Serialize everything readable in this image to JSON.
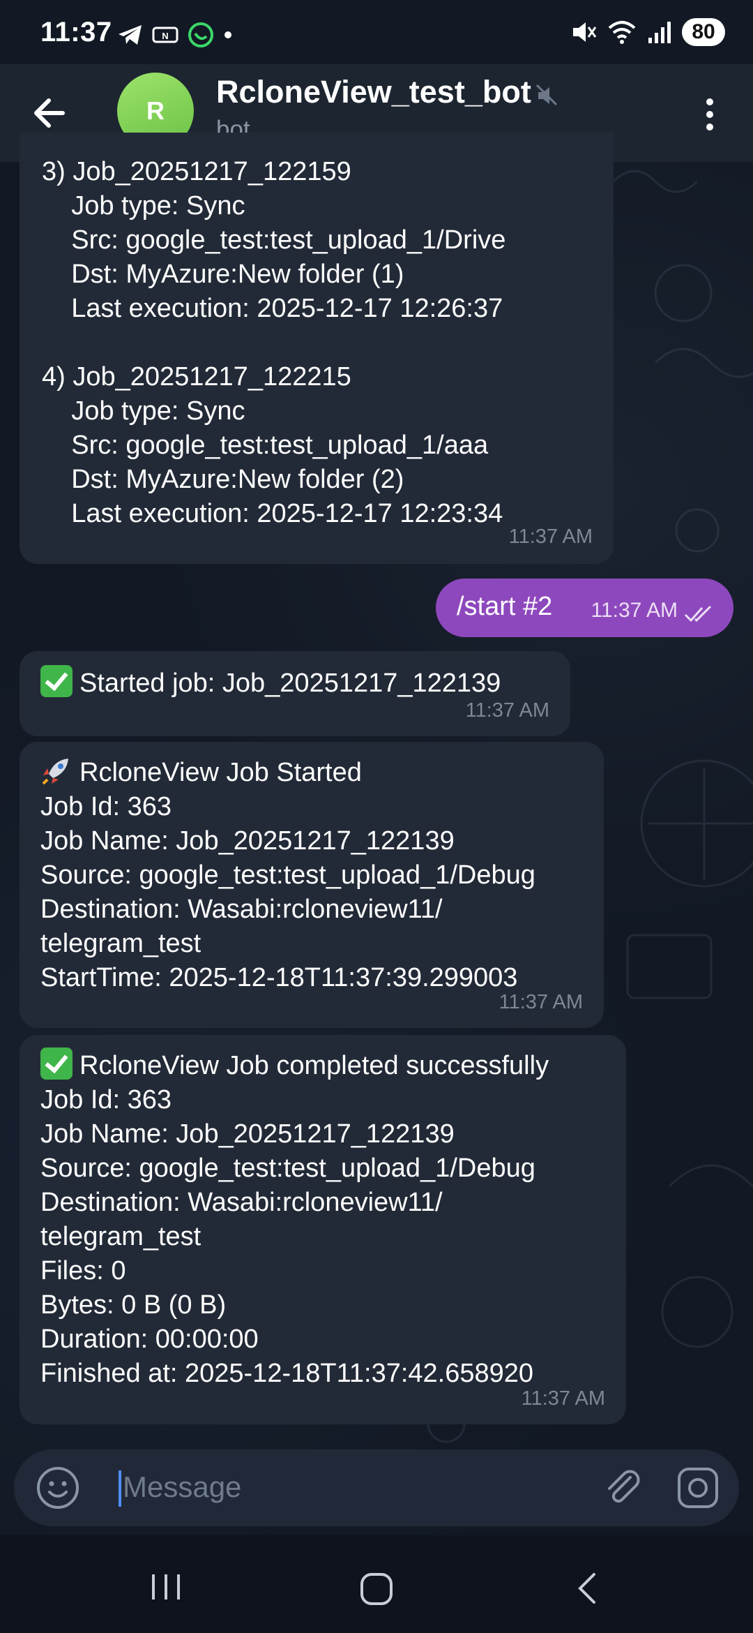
{
  "status_bar": {
    "time": "11:37",
    "battery": "80",
    "left_icons": [
      "telegram-icon",
      "nfc-icon",
      "whatsapp-icon",
      "dot-icon"
    ],
    "right_icons": [
      "mute-icon",
      "wifi-icon",
      "signal-icon",
      "battery-icon"
    ]
  },
  "header": {
    "avatar_letter": "R",
    "title": "RcloneView_test_bot",
    "subtitle": "bot"
  },
  "messages": [
    {
      "id": "jobs-list",
      "text": "3) Job_20251217_122159\n    Job type: Sync\n    Src: google_test:test_upload_1/Drive\n    Dst: MyAzure:New folder (1)\n    Last execution: 2025-12-17 12:26:37\n\n4) Job_20251217_122215\n    Job type: Sync\n    Src: google_test:test_upload_1/aaa\n    Dst: MyAzure:New folder (2)\n    Last execution: 2025-12-17 12:23:34",
      "time": "11:37 AM"
    },
    {
      "id": "outgoing",
      "text": "/start #2",
      "time": "11:37 AM"
    },
    {
      "id": "started",
      "text": "Started job: Job_20251217_122139",
      "time": "11:37 AM"
    },
    {
      "id": "job-started",
      "text": "RcloneView Job Started\nJob Id: 363\nJob Name: Job_20251217_122139\nSource: google_test:test_upload_1/Debug\nDestination: Wasabi:rcloneview11/\ntelegram_test\nStartTime: 2025-12-18T11:37:39.299003",
      "time": "11:37 AM"
    },
    {
      "id": "job-completed",
      "text": "RcloneView Job completed successfully\nJob Id: 363\nJob Name: Job_20251217_122139\nSource: google_test:test_upload_1/Debug\nDestination: Wasabi:rcloneview11/\ntelegram_test\nFiles: 0\nBytes: 0 B (0 B)\nDuration: 00:00:00\nFinished at: 2025-12-18T11:37:42.658920",
      "time": "11:37 AM"
    }
  ],
  "composer": {
    "placeholder": "Message"
  },
  "colors": {
    "outgoing_bubble": "#8e48bd",
    "incoming_bubble": "#232a37",
    "avatar": "#7fd157",
    "background": "#121924"
  }
}
